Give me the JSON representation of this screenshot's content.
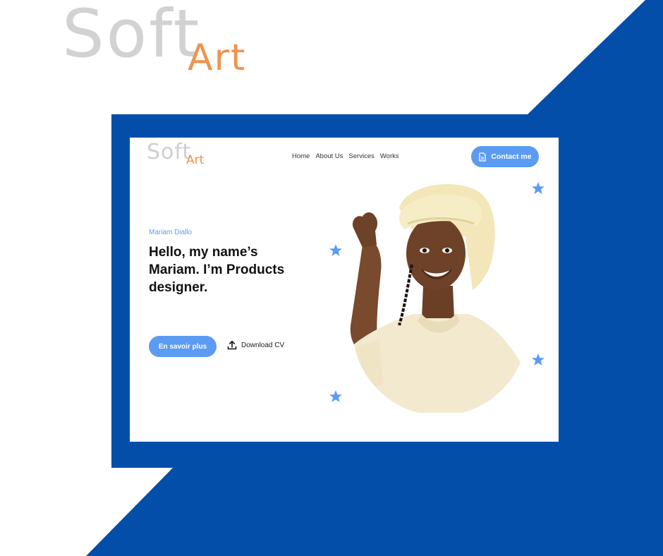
{
  "brand": {
    "soft": "Soft",
    "art": "Art"
  },
  "colors": {
    "blue_dark": "#034ea9",
    "blue_light": "#5b9bf3",
    "orange": "#f0944e",
    "logo_grey": "#d2d2d2"
  },
  "site": {
    "logo": {
      "soft": "Soft",
      "art": "Art"
    },
    "nav": [
      {
        "label": "Home"
      },
      {
        "label": "About Us"
      },
      {
        "label": "Services"
      },
      {
        "label": "Works"
      }
    ],
    "contact_button": {
      "label": "Contact me",
      "icon": "document-icon"
    },
    "hero": {
      "subtitle": "Mariam Diallo",
      "headline": "Hello, my name’s Mariam. I’m Products designer.",
      "primary_button": "En savoir plus",
      "download": {
        "label": "Download CV",
        "icon": "upload-icon"
      },
      "decor_icon": "star-icon"
    }
  }
}
